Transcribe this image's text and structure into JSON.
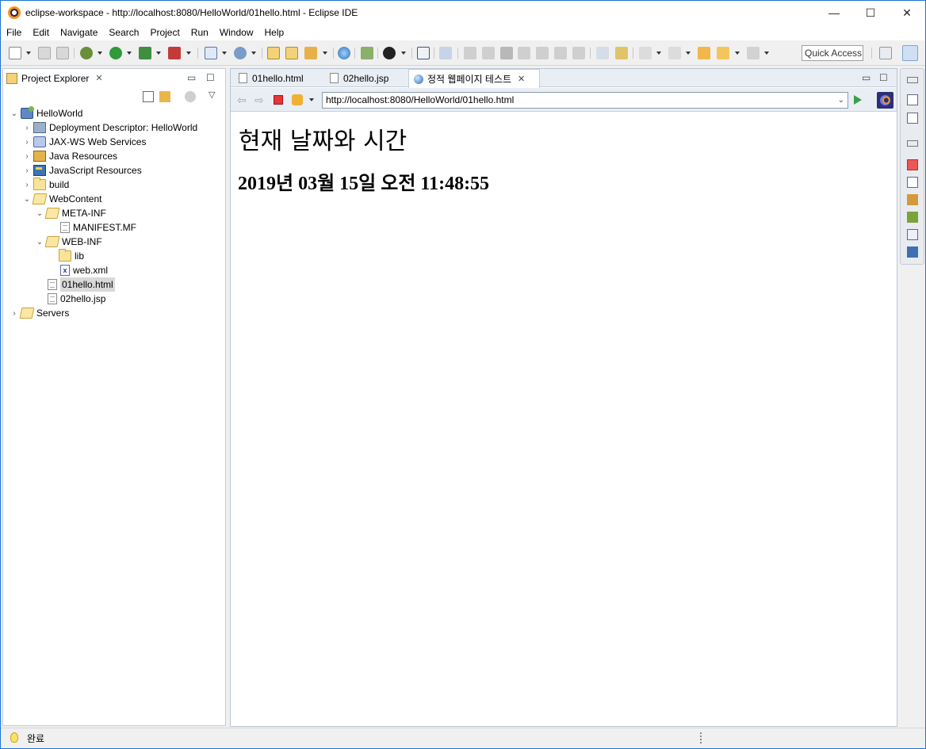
{
  "window": {
    "title": "eclipse-workspace - http://localhost:8080/HelloWorld/01hello.html - Eclipse IDE",
    "controls": {
      "minimize": "—",
      "maximize": "☐",
      "close": "✕"
    }
  },
  "menu": [
    "File",
    "Edit",
    "Navigate",
    "Search",
    "Project",
    "Run",
    "Window",
    "Help"
  ],
  "toolbar": {
    "quick_access": "Quick Access"
  },
  "explorer": {
    "tab_label": "Project Explorer",
    "close_glyph": "✕",
    "tree": [
      {
        "label": "HelloWorld",
        "twist": "⌄",
        "icon": "project-icon"
      },
      {
        "label": "Deployment Descriptor: HelloWorld",
        "twist": "›",
        "icon": "deployment-descriptor-icon"
      },
      {
        "label": "JAX-WS Web Services",
        "twist": "›",
        "icon": "web-services-icon"
      },
      {
        "label": "Java Resources",
        "twist": "›",
        "icon": "java-resources-icon"
      },
      {
        "label": "JavaScript Resources",
        "twist": "›",
        "icon": "javascript-resources-icon"
      },
      {
        "label": "build",
        "twist": "›",
        "icon": "folder-icon"
      },
      {
        "label": "WebContent",
        "twist": "⌄",
        "icon": "folder-open-icon"
      },
      {
        "label": "META-INF",
        "twist": "⌄",
        "icon": "folder-open-icon"
      },
      {
        "label": "MANIFEST.MF",
        "twist": "",
        "icon": "file-icon"
      },
      {
        "label": "WEB-INF",
        "twist": "⌄",
        "icon": "folder-open-icon"
      },
      {
        "label": "lib",
        "twist": "",
        "icon": "folder-icon"
      },
      {
        "label": "web.xml",
        "twist": "",
        "icon": "xml-file-icon"
      },
      {
        "label": "01hello.html",
        "twist": "",
        "icon": "html-file-icon",
        "selected": true
      },
      {
        "label": "02hello.jsp",
        "twist": "",
        "icon": "jsp-file-icon"
      },
      {
        "label": "Servers",
        "twist": "›",
        "icon": "servers-folder-icon"
      }
    ]
  },
  "editor": {
    "tabs": [
      {
        "label": "01hello.html",
        "active": false
      },
      {
        "label": "02hello.jsp",
        "active": false
      },
      {
        "label": "정적 웹페이지 테스트",
        "active": true
      }
    ],
    "close_glyph": "✕",
    "url": "http://localhost:8080/HelloWorld/01hello.html"
  },
  "page": {
    "heading": "현재 날짜와 시간",
    "datetime": "2019년 03월 15일 오전 11:48:55"
  },
  "status": {
    "text": "완료"
  }
}
